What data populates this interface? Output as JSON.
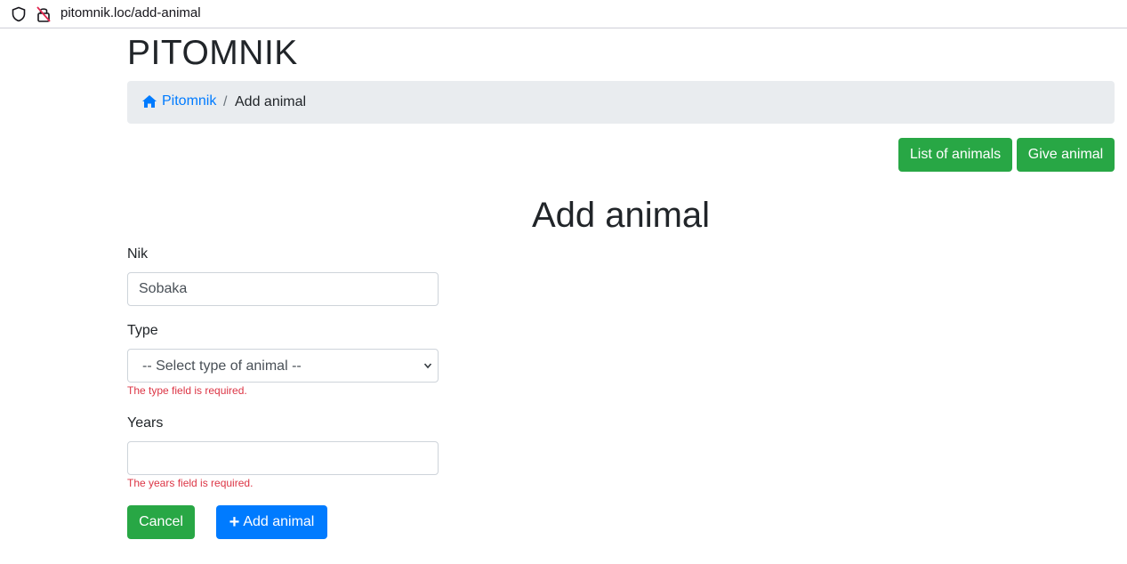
{
  "browser": {
    "url": "pitomnik.loc/add-animal"
  },
  "brand": "PITOMNIK",
  "breadcrumb": {
    "home": "Pitomnik",
    "separator": "/",
    "current": "Add animal"
  },
  "nav_buttons": {
    "list": "List of animals",
    "give": "Give animal"
  },
  "page_title": "Add animal",
  "form": {
    "nik": {
      "label": "Nik",
      "value": "Sobaka"
    },
    "type": {
      "label": "Type",
      "selected": "-- Select type of animal --",
      "error": "The type field is required."
    },
    "years": {
      "label": "Years",
      "value": "",
      "error": "The years field is required."
    }
  },
  "actions": {
    "cancel": "Cancel",
    "add_icon": "+",
    "add": "Add animal"
  },
  "colors": {
    "success": "#28a745",
    "primary": "#007bff",
    "danger": "#dc3545",
    "breadcrumb_bg": "#e9ecef"
  }
}
